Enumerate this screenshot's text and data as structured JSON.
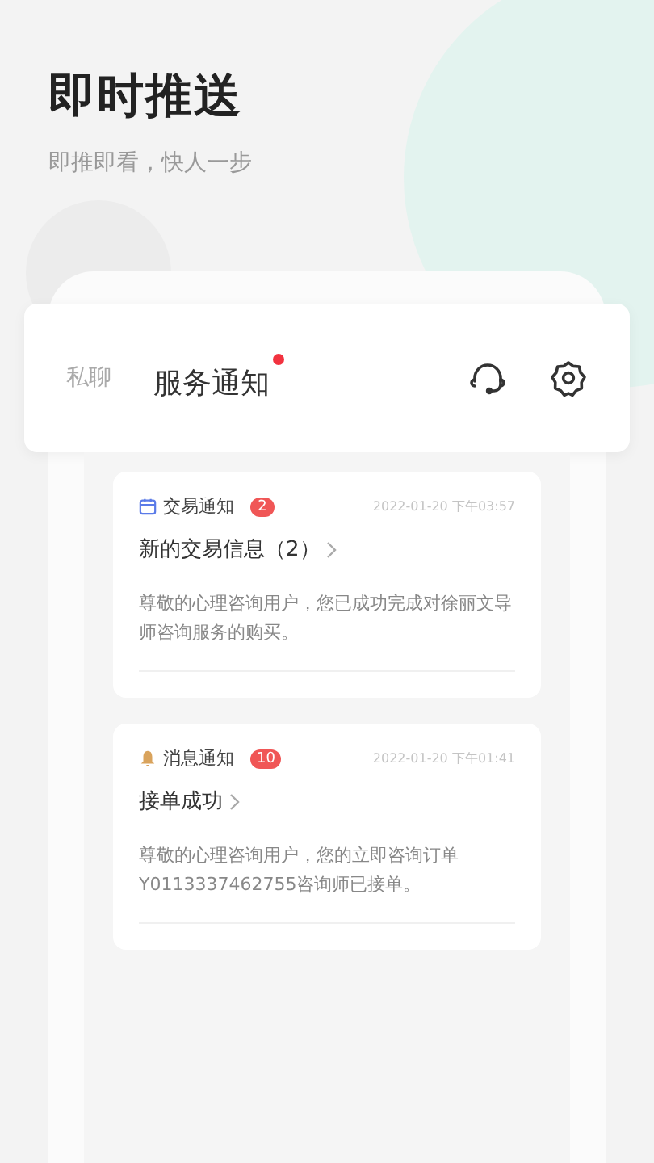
{
  "header": {
    "title": "即时推送",
    "subtitle": "即推即看，快人一步"
  },
  "tabs": [
    {
      "label": "私聊",
      "selected": false,
      "unread": false
    },
    {
      "label": "服务通知",
      "selected": true,
      "unread": true
    }
  ],
  "notifications": [
    {
      "kind": "trade",
      "category": "交易通知",
      "count": "2",
      "time": "2022-01-20 下午03:57",
      "title": "新的交易信息（2）",
      "body": "尊敬的心理咨询用户，您已成功完成对徐丽文导师咨询服务的购买。"
    },
    {
      "kind": "message",
      "category": "消息通知",
      "count": "10",
      "time": "2022-01-20 下午01:41",
      "title": "接单成功",
      "body": "尊敬的心理咨询用户，您的立即咨询订单Y0113337462755咨询师已接单。"
    }
  ]
}
